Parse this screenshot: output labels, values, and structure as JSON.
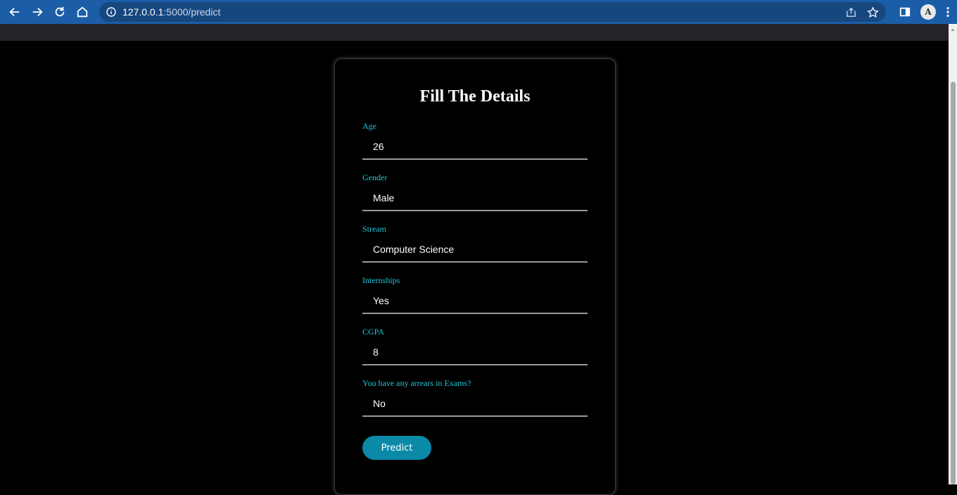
{
  "browser": {
    "url_host": "127.0.0.1",
    "url_path": ":5000/predict",
    "avatar_initial": "A"
  },
  "form": {
    "title": "Fill The Details",
    "fields": [
      {
        "label": "Age",
        "value": "26"
      },
      {
        "label": "Gender",
        "value": "Male"
      },
      {
        "label": "Stream",
        "value": "Computer Science"
      },
      {
        "label": "Internships",
        "value": "Yes"
      },
      {
        "label": "CGPA",
        "value": "8"
      },
      {
        "label": "You have any arrears in Exams?",
        "value": "No"
      }
    ],
    "submit_label": "Predict"
  },
  "colors": {
    "label": "#1fc7d8",
    "button": "#0b8aa8",
    "chrome": "#1b5da6"
  }
}
